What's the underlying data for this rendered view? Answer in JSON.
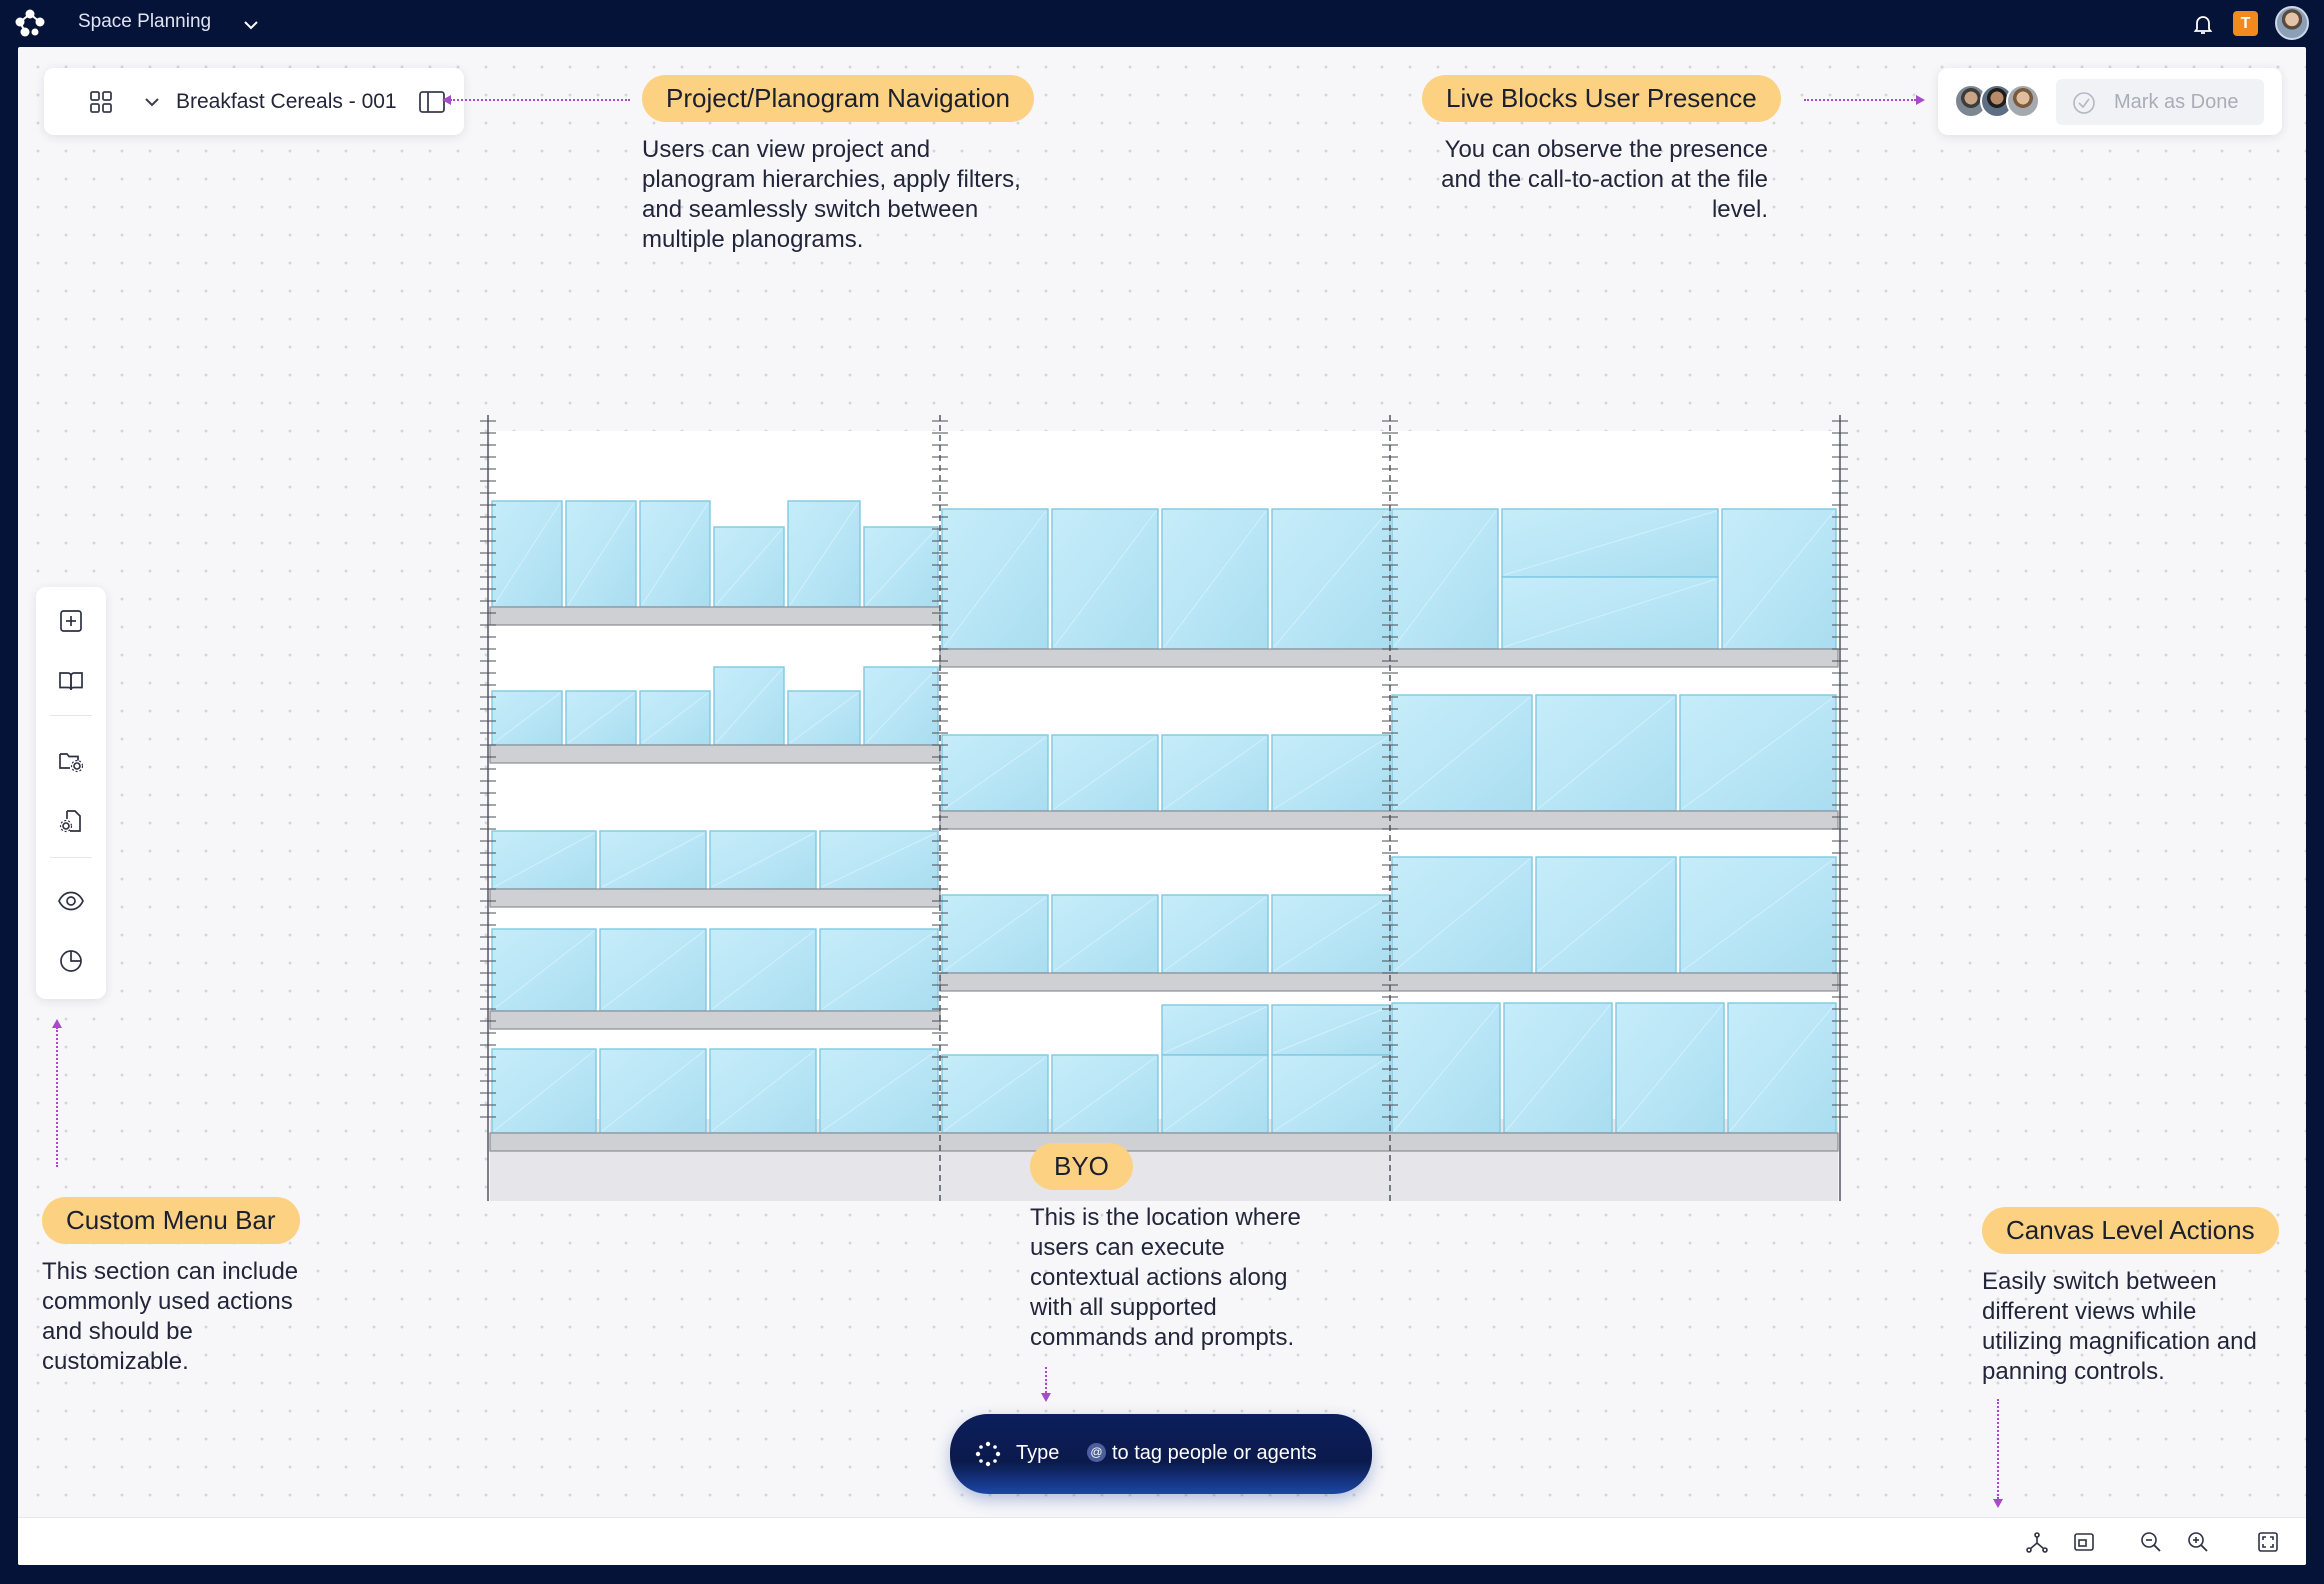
{
  "topbar": {
    "app_title": "Space Planning",
    "badge_letter": "T"
  },
  "nav_card": {
    "file_name": "Breakfast Cereals - 001"
  },
  "presence_card": {
    "mark_done_label": "Mark as Done"
  },
  "callouts": {
    "navigation": {
      "title": "Project/Planogram Navigation",
      "lines": [
        "Users can view project and",
        "planogram hierarchies, apply filters,",
        "and seamlessly switch between",
        "multiple planograms."
      ]
    },
    "presence": {
      "title": "Live Blocks User Presence",
      "lines": [
        "You can observe the presence",
        "and the call-to-action at the file",
        "level."
      ]
    },
    "menu_bar": {
      "title": "Custom Menu Bar",
      "lines": [
        "This section can include",
        "commonly used actions",
        "and should be",
        "customizable."
      ]
    },
    "byo": {
      "title": "BYO",
      "lines": [
        "This is the location where",
        "users can execute",
        "contextual actions along",
        "with all supported",
        "commands and prompts."
      ]
    },
    "canvas_actions": {
      "title": "Canvas Level Actions",
      "lines": [
        "Easily switch between",
        "different views while",
        "utilizing magnification and",
        "panning controls."
      ]
    }
  },
  "prompt": {
    "before": "Type",
    "at_symbol": "@",
    "after": "to tag people or agents"
  },
  "colors": {
    "topbar_bg": "#061338",
    "pill_bg": "#fcd182",
    "connector": "#a74bc7",
    "product_fill": "#bfe9f7",
    "shelf_fill": "#cfd0d4"
  },
  "icons": {
    "topbar": [
      "app-logo-icon",
      "chevron-down-icon",
      "bell-icon"
    ],
    "nav_card": [
      "grid-icon",
      "chevron-down-icon",
      "sidebar-panel-icon"
    ],
    "left_toolbar": [
      "add-square-icon",
      "book-icon",
      "folder-settings-icon",
      "file-settings-icon",
      "eye-icon",
      "pie-chart-icon"
    ],
    "bottom_bar": [
      "share-nodes-icon",
      "fit-to-screen-icon",
      "zoom-out-icon",
      "zoom-in-icon",
      "fullscreen-icon"
    ]
  }
}
